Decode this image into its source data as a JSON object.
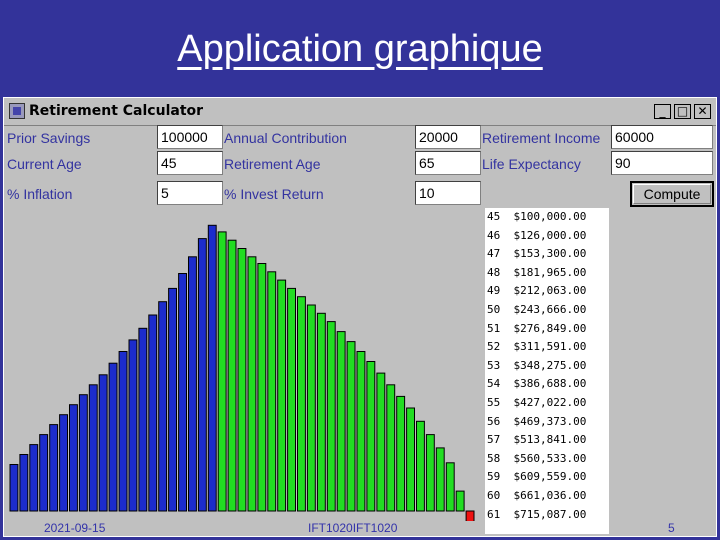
{
  "slide": {
    "title": "Application graphique",
    "footer_date": "2021-09-15",
    "footer_course": "IFT1020IFT1020",
    "page_number": "5"
  },
  "window": {
    "title": "Retirement Calculator",
    "controls": {
      "minimize": "_",
      "maximize": "□",
      "close": "✕"
    }
  },
  "form": {
    "prior_savings": {
      "label": "Prior Savings",
      "value": "100000"
    },
    "annual_contribution": {
      "label": "Annual Contribution",
      "value": "20000"
    },
    "retirement_income": {
      "label": "Retirement Income",
      "value": "60000"
    },
    "current_age": {
      "label": "Current Age",
      "value": "45"
    },
    "retirement_age": {
      "label": "Retirement Age",
      "value": "65"
    },
    "life_expectancy": {
      "label": "Life Expectancy",
      "value": "90"
    },
    "inflation": {
      "label": "% Inflation",
      "value": "5"
    },
    "invest_return": {
      "label": "% Invest Return",
      "value": "10"
    },
    "compute_label": "Compute"
  },
  "results": [
    {
      "age": "45",
      "amount": "$100,000.00"
    },
    {
      "age": "46",
      "amount": "$126,000.00"
    },
    {
      "age": "47",
      "amount": "$153,300.00"
    },
    {
      "age": "48",
      "amount": "$181,965.00"
    },
    {
      "age": "49",
      "amount": "$212,063.00"
    },
    {
      "age": "50",
      "amount": "$243,666.00"
    },
    {
      "age": "51",
      "amount": "$276,849.00"
    },
    {
      "age": "52",
      "amount": "$311,591.00"
    },
    {
      "age": "53",
      "amount": "$348,275.00"
    },
    {
      "age": "54",
      "amount": "$386,688.00"
    },
    {
      "age": "55",
      "amount": "$427,022.00"
    },
    {
      "age": "56",
      "amount": "$469,373.00"
    },
    {
      "age": "57",
      "amount": "$513,841.00"
    },
    {
      "age": "58",
      "amount": "$560,533.00"
    },
    {
      "age": "59",
      "amount": "$609,559.00"
    },
    {
      "age": "60",
      "amount": "$661,036.00"
    },
    {
      "age": "61",
      "amount": "$715,087.00"
    }
  ],
  "chart_data": {
    "type": "bar",
    "colors": {
      "accumulation": "#1c2ccc",
      "withdrawal": "#22dd22",
      "negative": "#ee1111",
      "outline": "#000000"
    },
    "series": [
      {
        "values": [
          2.8,
          3.4,
          4.0,
          4.6,
          5.2,
          5.8,
          6.4,
          7.0,
          7.6,
          8.2,
          8.9,
          9.6,
          10.3,
          11.0,
          11.8,
          12.6,
          13.4,
          14.3,
          15.3,
          16.4,
          17.2
        ]
      },
      {
        "values": [
          16.8,
          16.3,
          15.8,
          15.3,
          14.9,
          14.4,
          13.9,
          13.4,
          12.9,
          12.4,
          11.9,
          11.4,
          10.8,
          10.2,
          9.6,
          9.0,
          8.3,
          7.6,
          6.9,
          6.2,
          5.4,
          4.6,
          3.8,
          2.9,
          1.2
        ]
      },
      {
        "values": [
          -1.0
        ]
      }
    ]
  }
}
